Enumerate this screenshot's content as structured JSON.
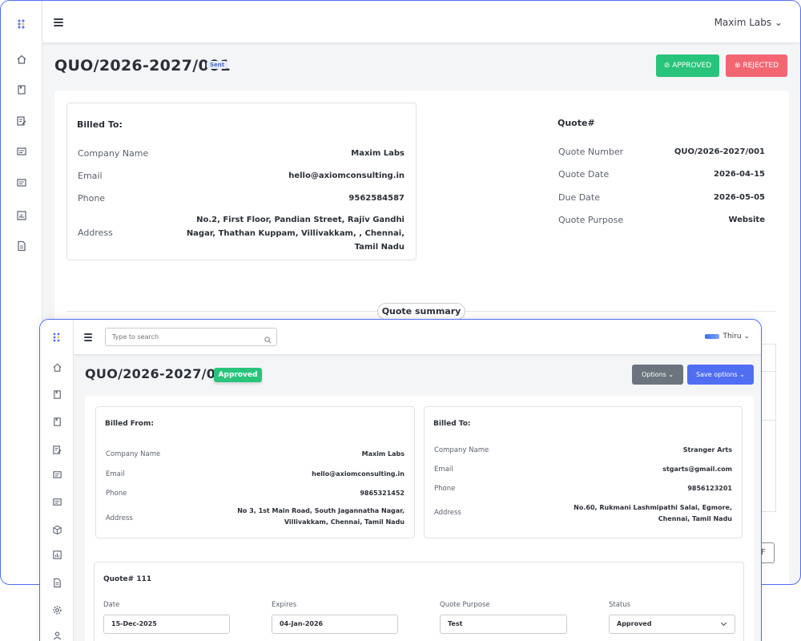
{
  "back": {
    "user_menu": "Maxim Labs ⌄",
    "title": "QUO/2026-2027/001",
    "status_badge": "Sent",
    "approve_label": "⊘ APPROVED",
    "reject_label": "⊗ REJECTED",
    "billed_to": {
      "heading": "Billed To:",
      "rows": [
        {
          "label": "Company Name",
          "value": "Maxim Labs"
        },
        {
          "label": "Email",
          "value": "hello@axiomconsulting.in"
        },
        {
          "label": "Phone",
          "value": "9562584587"
        },
        {
          "label": "Address",
          "value_lines": [
            "No.2, First Floor, Pandian Street, Rajiv Gandhi",
            "Nagar, Thathan Kuppam, Villivakkam, , Chennai,",
            "Tamil Nadu"
          ]
        }
      ]
    },
    "quote": {
      "heading": "Quote#",
      "rows": [
        {
          "label": "Quote Number",
          "value": "QUO/2026-2027/001"
        },
        {
          "label": "Quote Date",
          "value": "2026-04-15"
        },
        {
          "label": "Due Date",
          "value": "2026-05-05"
        },
        {
          "label": "Quote Purpose",
          "value": "Website"
        }
      ]
    },
    "summary_label": "Quote summary",
    "peek_button": "F"
  },
  "front": {
    "search_placeholder": "Type to search",
    "user_name": "Thiru ⌄",
    "title": "QUO/2026-2027/001",
    "status_badge": "Approved",
    "options_label": "Options ⌄",
    "save_options_label": "Save options ⌄",
    "billed_from": {
      "heading": "Billed From:",
      "rows": [
        {
          "label": "Company Name",
          "value": "Maxim Labs"
        },
        {
          "label": "Email",
          "value": "hello@axiomconsulting.in"
        },
        {
          "label": "Phone",
          "value": "9865321452"
        },
        {
          "label": "Address",
          "value_lines": [
            "No 3, 1st Main Road, South Jagannatha Nagar,",
            "Villivakkam, Chennai, Tamil Nadu"
          ]
        }
      ]
    },
    "billed_to": {
      "heading": "Billed To:",
      "rows": [
        {
          "label": "Company Name",
          "value": "Stranger Arts"
        },
        {
          "label": "Email",
          "value": "stgarts@gmail.com"
        },
        {
          "label": "Phone",
          "value": "9856123201"
        },
        {
          "label": "Address",
          "value_lines": [
            "No.60, Rukmani Lashmipathi Salai, Egmore,",
            "Chennai, Tamil Nadu"
          ]
        }
      ]
    },
    "quote": {
      "heading": "Quote# 111",
      "fields": [
        {
          "label": "Date",
          "value": "15-Dec-2025"
        },
        {
          "label": "Expires",
          "value": "04-Jan-2026"
        },
        {
          "label": "Quote Purpose",
          "value": "Test"
        },
        {
          "label": "Status",
          "value": "Approved"
        }
      ]
    }
  },
  "colors": {
    "accent": "#4f6ef2",
    "approved": "#28c47b",
    "rejected": "#f26672",
    "options_gray": "#6c757d"
  },
  "icons": {
    "back_sidebar": [
      "apps-icon",
      "home-icon",
      "bookmark-icon",
      "edit-note-icon",
      "list-card-icon",
      "list-card-icon",
      "chart-icon",
      "document-icon"
    ],
    "front_sidebar": [
      "apps-icon",
      "home-icon",
      "bookmark-icon",
      "bookmark-icon",
      "edit-note-icon",
      "list-card-icon",
      "list-card-icon",
      "package-icon",
      "chart-icon",
      "document-icon",
      "settings-icon",
      "user-icon"
    ]
  }
}
